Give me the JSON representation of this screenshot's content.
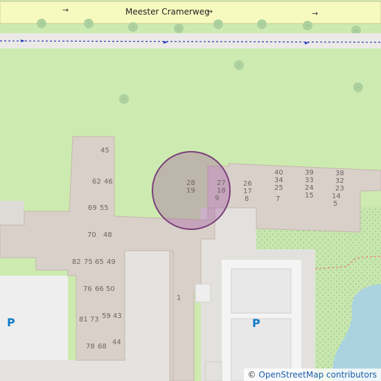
{
  "map": {
    "street_name": "Meester Cramerweg",
    "parking_symbol": "P",
    "attribution": {
      "prefix": "©",
      "text": "OpenStreetMap contributors"
    },
    "colors": {
      "grass": "#cdebb0",
      "building": "#d9d0c9",
      "building_outline": "#c3b6ab",
      "parking_area": "#eeeeee",
      "water": "#aad3df",
      "marker_fill": "#a052a0",
      "marker_stroke": "#7a3f7a",
      "road": "#f7fabf",
      "tree": "#add19e",
      "link": "#1a5da8",
      "parking_symbol": "#0f7ac7"
    },
    "house_numbers": [
      "45",
      "62",
      "46",
      "69",
      "55",
      "70",
      "48",
      "82",
      "75",
      "65",
      "49",
      "76",
      "66",
      "50",
      "81",
      "73",
      "59",
      "43",
      "78",
      "68",
      "44",
      "1",
      "28",
      "19",
      "27",
      "18",
      "9",
      "26",
      "17",
      "8",
      "40",
      "34",
      "25",
      "7",
      "39",
      "33",
      "24",
      "15",
      "38",
      "32",
      "23",
      "14",
      "5"
    ]
  }
}
